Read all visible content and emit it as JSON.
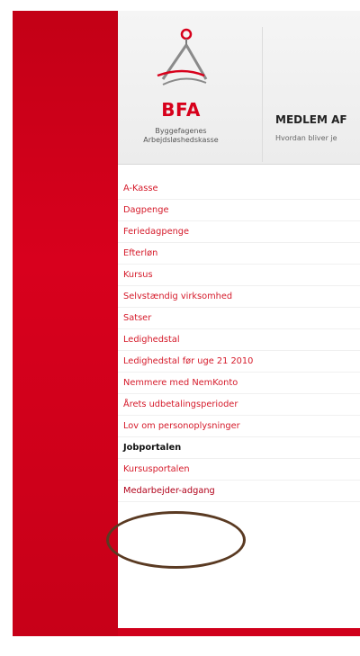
{
  "brand": {
    "name": "BFA",
    "subtitle_line1": "Byggefagenes",
    "subtitle_line2": "Arbejdsløshedskasse"
  },
  "header": {
    "title": "MEDLEM AF",
    "subtitle": "Hvordan bliver je"
  },
  "nav": {
    "items": [
      {
        "label": "A-Kasse"
      },
      {
        "label": "Dagpenge"
      },
      {
        "label": "Feriedagpenge"
      },
      {
        "label": "Efterløn"
      },
      {
        "label": "Kursus"
      },
      {
        "label": "Selvstændig virksomhed"
      },
      {
        "label": "Satser"
      },
      {
        "label": "Ledighedstal"
      },
      {
        "label": "Ledighedstal før uge 21 2010"
      },
      {
        "label": "Nemmere med NemKonto"
      },
      {
        "label": "Årets udbetalingsperioder"
      },
      {
        "label": "Lov om personoplysninger"
      },
      {
        "label": "Jobportalen"
      },
      {
        "label": "Kursusportalen"
      },
      {
        "label": "Medarbejder-adgang"
      }
    ]
  },
  "colors": {
    "accent": "#d7001b",
    "annotation_circle": "#5a3a22"
  },
  "icons": {
    "logo": "bfa-compass-logo-icon"
  }
}
